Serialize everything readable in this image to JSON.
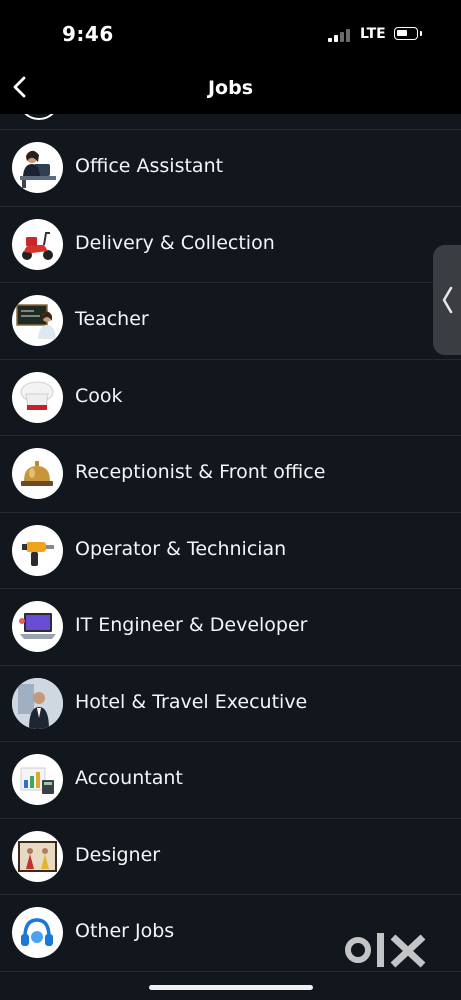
{
  "status_bar": {
    "time": "9:46",
    "network": "LTE"
  },
  "nav": {
    "title": "Jobs"
  },
  "jobs": [
    {
      "label": "Office Assistant",
      "icon": "office-assistant-icon"
    },
    {
      "label": "Delivery & Collection",
      "icon": "delivery-scooter-icon"
    },
    {
      "label": "Teacher",
      "icon": "teacher-icon"
    },
    {
      "label": "Cook",
      "icon": "chef-hat-icon"
    },
    {
      "label": "Receptionist & Front office",
      "icon": "service-bell-icon"
    },
    {
      "label": "Operator & Technician",
      "icon": "drill-icon"
    },
    {
      "label": "IT Engineer & Developer",
      "icon": "laptop-icon"
    },
    {
      "label": "Hotel & Travel Executive",
      "icon": "hotel-executive-icon"
    },
    {
      "label": "Accountant",
      "icon": "accountant-icon"
    },
    {
      "label": "Designer",
      "icon": "designer-icon"
    },
    {
      "label": "Other Jobs",
      "icon": "headset-icon"
    }
  ],
  "brand": {
    "logo": "olx-logo",
    "accent": "#f2f3f5",
    "background": "#12161d"
  }
}
